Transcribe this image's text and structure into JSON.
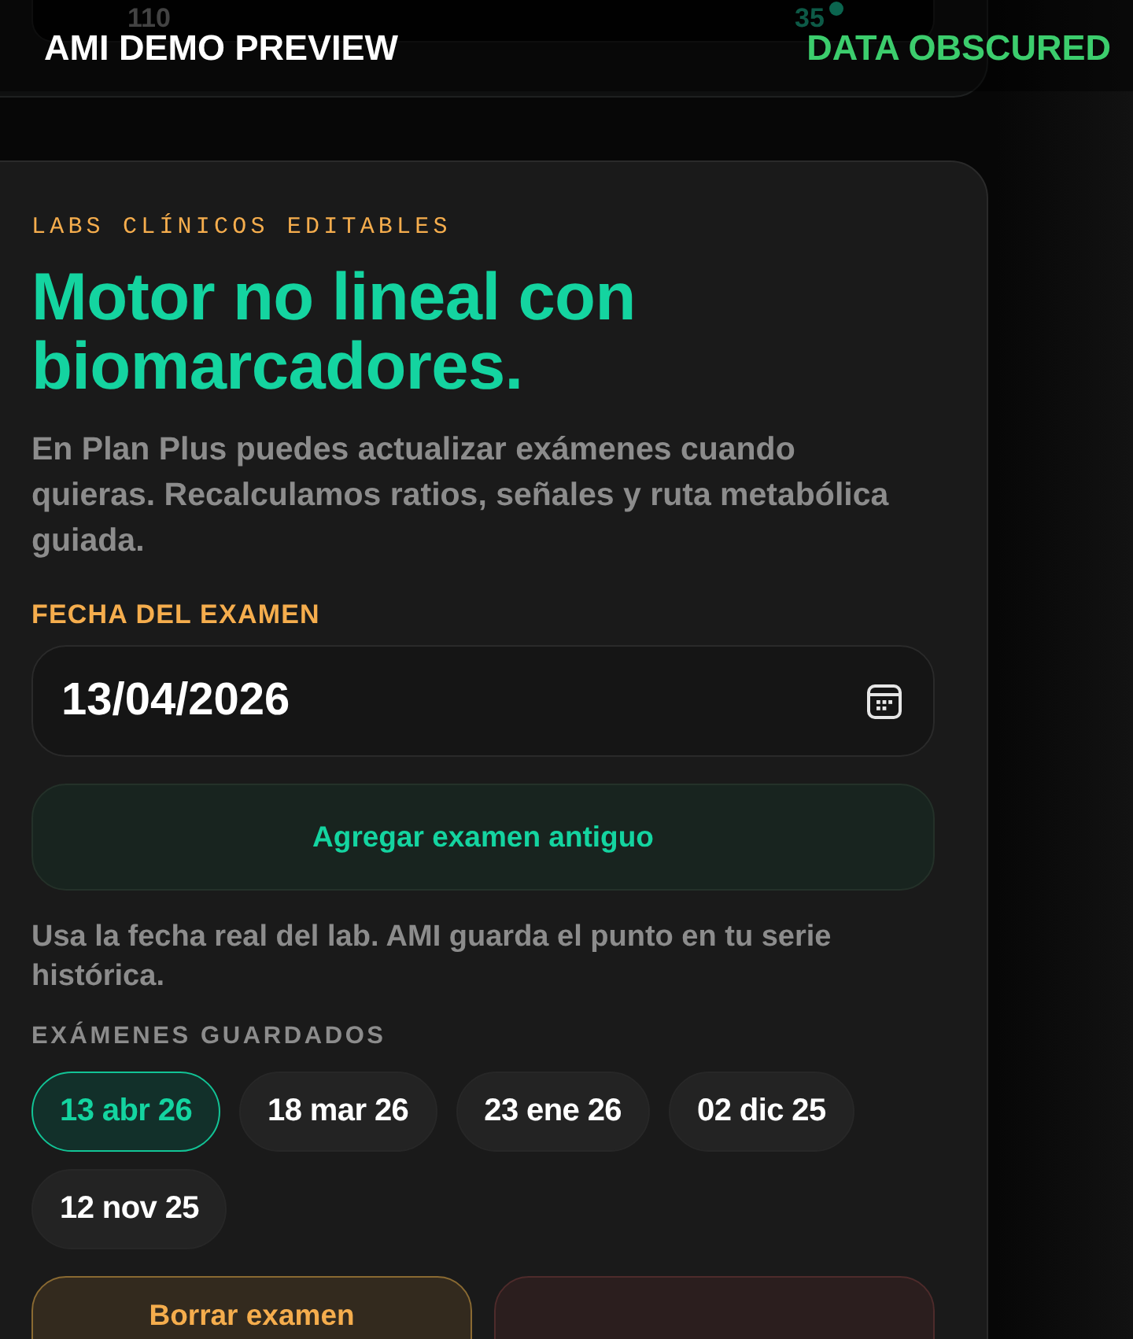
{
  "banner": {
    "left": "AMI DEMO PREVIEW",
    "right": "DATA OBSCURED"
  },
  "previous_card": {
    "value_1": "110",
    "value_2": "35"
  },
  "labs_card": {
    "eyebrow": "LABS CLÍNICOS EDITABLES",
    "title": "Motor no lineal con biomarcadores.",
    "description": "En Plan Plus puedes actualizar exámenes cuando quieras. Recalculamos ratios, señales y ruta metabólica guiada.",
    "date_label": "FECHA DEL EXAMEN",
    "date_field": {
      "value": "13/04/2026"
    },
    "add_button": "Agregar examen antiguo",
    "hint": "Usa la fecha real del lab. AMI guarda el punto en tu serie histórica.",
    "saved_label": "EXÁMENES GUARDADOS",
    "saved_exams": [
      {
        "label": "13 abr 26",
        "selected": true
      },
      {
        "label": "18 mar 26",
        "selected": false
      },
      {
        "label": "23 ene 26",
        "selected": false
      },
      {
        "label": "02 dic 25",
        "selected": false
      },
      {
        "label": "12 nov 25",
        "selected": false
      }
    ],
    "actions": [
      {
        "kind": "warning",
        "label": "Borrar examen"
      },
      {
        "kind": "danger"
      }
    ]
  }
}
